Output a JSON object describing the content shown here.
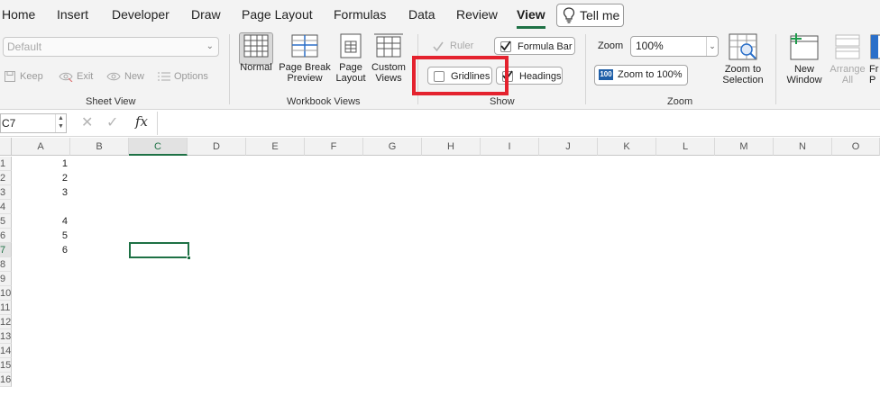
{
  "tabs": [
    {
      "label": "Home",
      "active": false
    },
    {
      "label": "Insert",
      "active": false
    },
    {
      "label": "Developer",
      "active": false
    },
    {
      "label": "Draw",
      "active": false
    },
    {
      "label": "Page Layout",
      "active": false
    },
    {
      "label": "Formulas",
      "active": false
    },
    {
      "label": "Data",
      "active": false
    },
    {
      "label": "Review",
      "active": false
    },
    {
      "label": "View",
      "active": true
    }
  ],
  "tell_me": "Tell me",
  "sheet_view": {
    "select_value": "Default",
    "keep": "Keep",
    "exit": "Exit",
    "new": "New",
    "options": "Options",
    "group_label": "Sheet View"
  },
  "workbook_views": {
    "normal": "Normal",
    "page_break_1": "Page Break",
    "page_break_2": "Preview",
    "page_layout_1": "Page",
    "page_layout_2": "Layout",
    "custom_1": "Custom",
    "custom_2": "Views",
    "group_label": "Workbook Views"
  },
  "show": {
    "ruler": "Ruler",
    "formula_bar": "Formula Bar",
    "gridlines": "Gridlines",
    "headings": "Headings",
    "group_label": "Show",
    "ruler_checked": true,
    "formula_bar_checked": true,
    "gridlines_checked": false,
    "headings_checked": true
  },
  "zoom": {
    "label": "Zoom",
    "value": "100%",
    "zoom100_badge": "100",
    "zoom100": "Zoom to 100%",
    "selection_1": "Zoom to",
    "selection_2": "Selection",
    "group_label": "Zoom"
  },
  "window": {
    "new_1": "New",
    "new_2": "Window",
    "arrange_1": "Arrange",
    "arrange_2": "All",
    "freeze_1": "Fr",
    "freeze_2": "P"
  },
  "formula_bar": {
    "name_box": "C7",
    "cancel": "✕",
    "enter": "✓",
    "fx": "fx"
  },
  "grid": {
    "columns": [
      "A",
      "B",
      "C",
      "D",
      "E",
      "F",
      "G",
      "H",
      "I",
      "J",
      "K",
      "L",
      "M",
      "N",
      "O"
    ],
    "active_column": "C",
    "rows": [
      "1",
      "2",
      "3",
      "4",
      "5",
      "6",
      "7",
      "8",
      "9",
      "10",
      "11",
      "12",
      "13",
      "14",
      "15",
      "16"
    ],
    "active_row": "7",
    "column_a_values": [
      "1",
      "2",
      "3",
      "",
      "4",
      "5",
      "6"
    ]
  },
  "colors": {
    "accent_green": "#1e7145",
    "highlight_red": "#e4222e"
  }
}
